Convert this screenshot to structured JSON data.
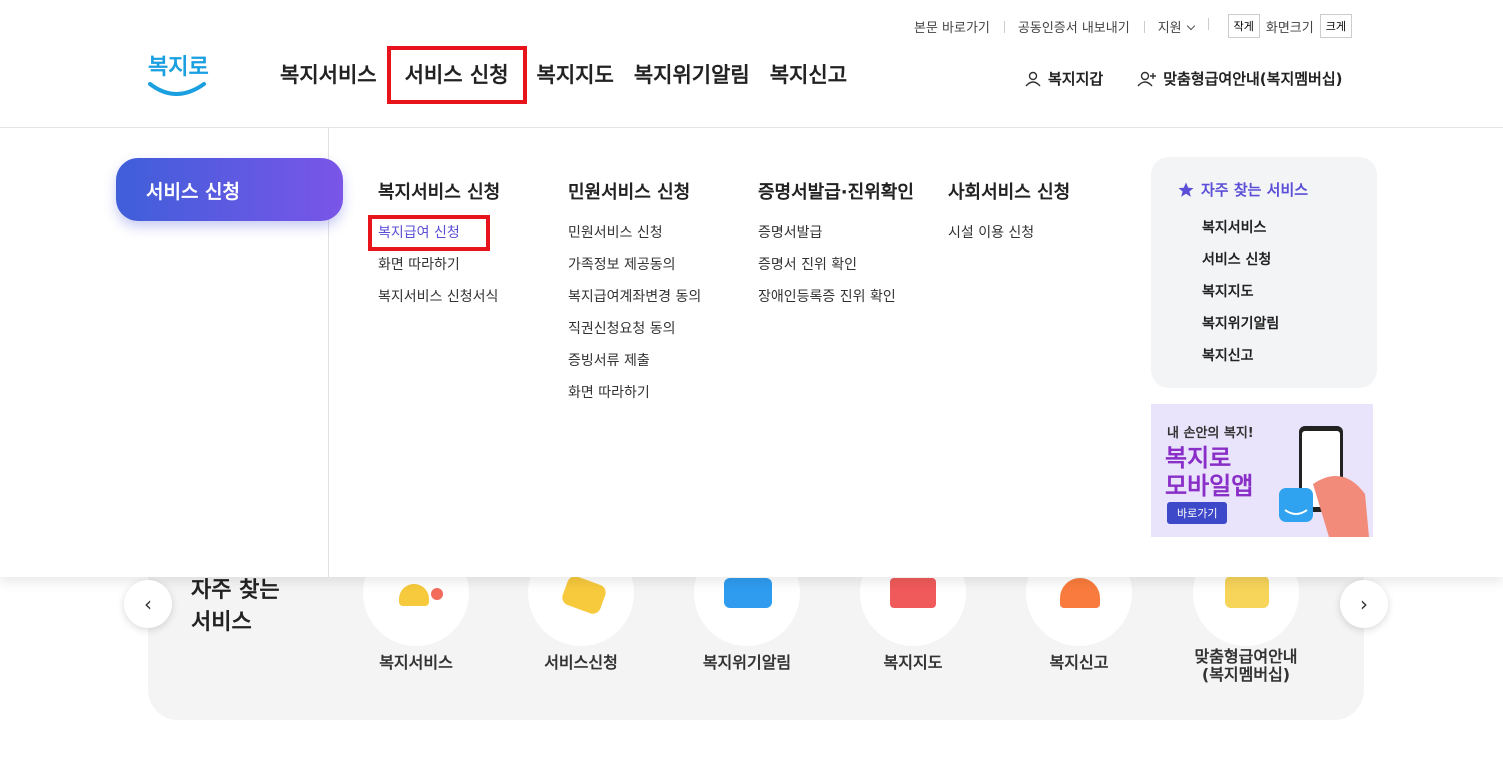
{
  "utility": {
    "skip_link": "본문 바로가기",
    "cert_export": "공동인증서 내보내기",
    "support": "지원",
    "font_small": "작게",
    "font_size": "화면크기",
    "font_large": "크게"
  },
  "logo": {
    "text": "복지로"
  },
  "gnb": [
    {
      "label": "복지서비스"
    },
    {
      "label": "서비스 신청"
    },
    {
      "label": "복지지도"
    },
    {
      "label": "복지위기알림"
    },
    {
      "label": "복지신고"
    }
  ],
  "user_links": {
    "wallet": "복지지갑",
    "membership": "맞춤형급여안내(복지멤버십)"
  },
  "mega": {
    "title": "서비스 신청",
    "columns": [
      {
        "heading": "복지서비스 신청",
        "items": [
          "복지급여 신청",
          "화면 따라하기",
          "복지서비스 신청서식"
        ]
      },
      {
        "heading": "민원서비스 신청",
        "items": [
          "민원서비스 신청",
          "가족정보 제공동의",
          "복지급여계좌변경 동의",
          "직권신청요청 동의",
          "증빙서류 제출",
          "화면 따라하기"
        ]
      },
      {
        "heading": "증명서발급·진위확인",
        "items": [
          "증명서발급",
          "증명서 진위 확인",
          "장애인등록증 진위 확인"
        ]
      },
      {
        "heading": "사회서비스 신청",
        "items": [
          "시설 이용 신청"
        ]
      }
    ],
    "favorites": {
      "title": "자주 찾는 서비스",
      "items": [
        "복지서비스",
        "서비스 신청",
        "복지지도",
        "복지위기알림",
        "복지신고"
      ]
    },
    "banner": {
      "line1": "내 손안의 복지!",
      "line2": "복지로",
      "line3": "모바일앱",
      "button": "바로가기"
    }
  },
  "quick": {
    "title_line1": "자주 찾는",
    "title_line2": "서비스",
    "items": [
      {
        "label": "복지서비스"
      },
      {
        "label": "서비스신청"
      },
      {
        "label": "복지위기알림"
      },
      {
        "label": "복지지도"
      },
      {
        "label": "복지신고"
      },
      {
        "label": "맞춤형급여안내",
        "label2": "(복지멤버십)"
      }
    ]
  },
  "colors": {
    "accent": "#5a4fd6",
    "highlight": "#e8141c",
    "logo_blue": "#1a9fe0"
  }
}
